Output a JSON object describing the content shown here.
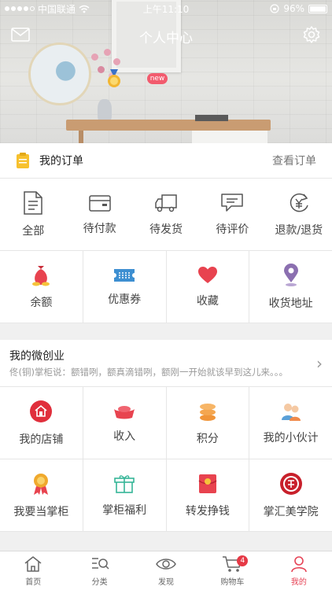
{
  "status_bar": {
    "carrier": "中国联通",
    "time": "上午11:10",
    "battery": "96%"
  },
  "header": {
    "title": "个人中心",
    "badge": "new"
  },
  "orders": {
    "title": "我的订单",
    "view_all": "查看订单",
    "items": [
      {
        "label": "全部",
        "icon": "document-icon"
      },
      {
        "label": "待付款",
        "icon": "wallet-icon"
      },
      {
        "label": "待发货",
        "icon": "truck-icon"
      },
      {
        "label": "待评价",
        "icon": "comment-icon"
      },
      {
        "label": "退款/退货",
        "icon": "refund-icon"
      }
    ]
  },
  "wallet": {
    "items": [
      {
        "label": "余额",
        "icon": "money-bag-icon",
        "color": "#e8434f"
      },
      {
        "label": "优惠券",
        "icon": "coupon-icon",
        "color": "#3d8fd1"
      },
      {
        "label": "收藏",
        "icon": "heart-icon",
        "color": "#e8434f"
      },
      {
        "label": "收货地址",
        "icon": "location-pin-icon",
        "color": "#8b6fb0"
      }
    ]
  },
  "business": {
    "title": "我的微创业",
    "desc": "佟(铜)掌柜说：额错咧，额真滴错咧，额刚一开始就该早到这儿来。。。",
    "row1": [
      {
        "label": "我的店铺",
        "icon": "shop-icon",
        "color": "#e02f3c"
      },
      {
        "label": "收入",
        "icon": "gold-ingot-icon",
        "color": "#e8434f"
      },
      {
        "label": "积分",
        "icon": "coins-icon",
        "color": "#f0953a"
      },
      {
        "label": "我的小伙计",
        "icon": "people-icon",
        "color": "#5aa0d8"
      }
    ],
    "row2": [
      {
        "label": "我要当掌柜",
        "icon": "medal-icon",
        "color": "#f0a92d"
      },
      {
        "label": "掌柜福利",
        "icon": "gift-icon",
        "color": "#35b597"
      },
      {
        "label": "转发挣钱",
        "icon": "red-envelope-icon",
        "color": "#e8434f"
      },
      {
        "label": "掌汇美学院",
        "icon": "academy-seal-icon",
        "color": "#c8202b"
      }
    ]
  },
  "tabbar": {
    "items": [
      {
        "label": "首页",
        "icon": "home-icon"
      },
      {
        "label": "分类",
        "icon": "category-search-icon"
      },
      {
        "label": "发现",
        "icon": "eye-icon"
      },
      {
        "label": "购物车",
        "icon": "cart-icon",
        "badge": "4"
      },
      {
        "label": "我的",
        "icon": "user-icon",
        "active": true
      }
    ]
  }
}
